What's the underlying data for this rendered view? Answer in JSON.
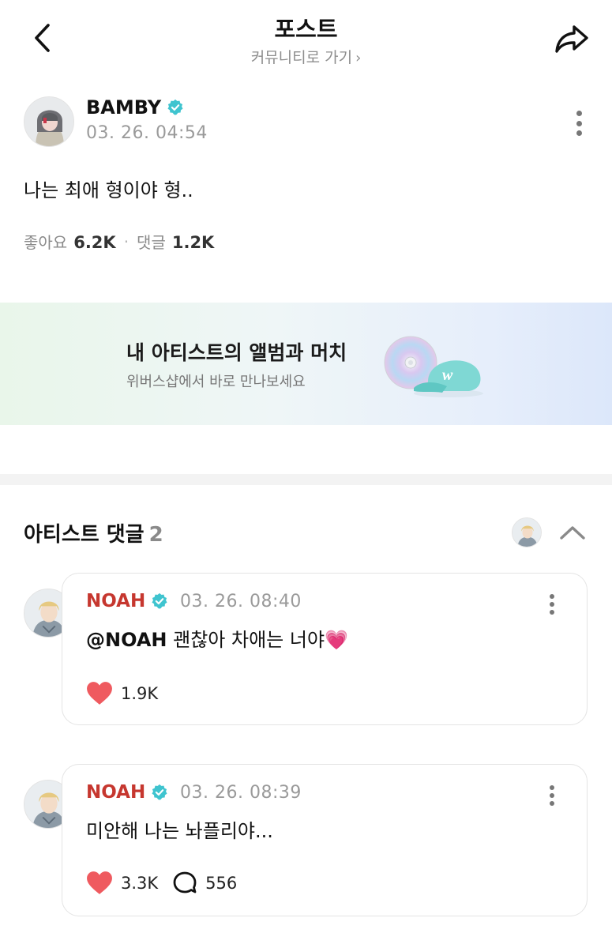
{
  "header": {
    "title": "포스트",
    "community_link": "커뮤니티로 가기",
    "chevron": "›"
  },
  "post": {
    "author": "BAMBY",
    "time": "03. 26. 04:54",
    "body": "나는 최애 형이야 형..",
    "likes_label": "좋아요",
    "likes": "6.2K",
    "separator": "·",
    "comments_label": "댓글",
    "comments": "1.2K"
  },
  "banner": {
    "title": "내 아티스트의 앨범과 머치",
    "subtitle": "위버스샵에서 바로 만나보세요"
  },
  "artist_comments": {
    "title": "아티스트 댓글",
    "count": "2",
    "items": [
      {
        "author": "NOAH",
        "time": "03. 26. 08:40",
        "mention": "@NOAH",
        "text": " 괜찮아 차애는 너야💗",
        "likes": "1.9K"
      },
      {
        "author": "NOAH",
        "time": "03. 26. 08:39",
        "mention": "",
        "text": "미안해 나는 놔플리야...",
        "likes": "3.3K",
        "replies": "556"
      }
    ]
  },
  "colors": {
    "verified": "#3fc4cf",
    "artist_name": "#c6372f",
    "heart": "#ef5a5f",
    "banner_from": "#e9f6ea",
    "banner_to": "#dce7fa"
  },
  "icons": [
    "back-arrow-icon",
    "share-icon",
    "verified-badge-icon",
    "more-vertical-icon",
    "chevron-up-icon",
    "heart-icon",
    "comment-bubble-icon"
  ]
}
